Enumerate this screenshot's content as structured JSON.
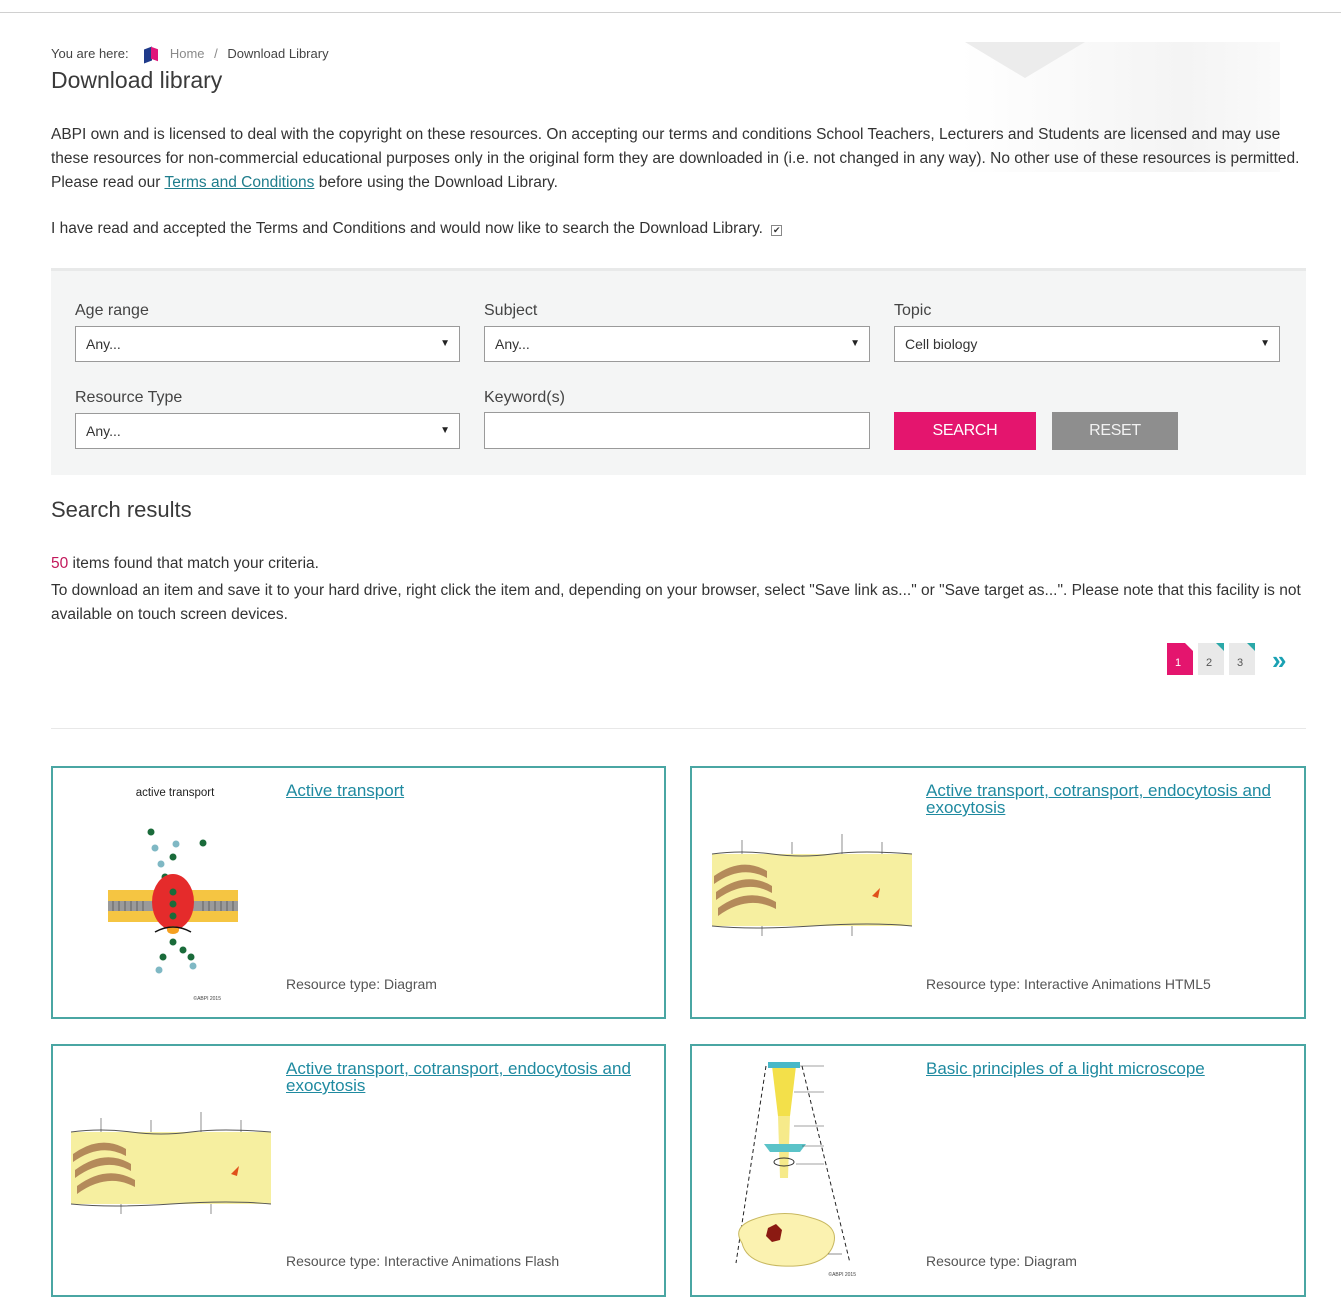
{
  "breadcrumb": {
    "prefix": "You are here:",
    "home": "Home",
    "separator": "/",
    "current": "Download Library"
  },
  "page_title": "Download library",
  "intro": {
    "text_before": "ABPI own and is licensed to deal with the copyright on these resources. On accepting our terms and conditions School Teachers, Lecturers and Students are licensed and may use these resources for non-commercial educational purposes only in the original form they are downloaded in (i.e. not changed in any way). No other use of these resources is permitted. Please read our ",
    "link": "Terms and Conditions",
    "text_after": " before using the Download Library."
  },
  "accept_text": "I have read and accepted the Terms and Conditions and would now like to search the Download Library.",
  "accept_checked": true,
  "filters": {
    "age_range": {
      "label": "Age range",
      "value": "Any..."
    },
    "subject": {
      "label": "Subject",
      "value": "Any..."
    },
    "topic": {
      "label": "Topic",
      "value": "Cell biology"
    },
    "resource_type": {
      "label": "Resource Type",
      "value": "Any..."
    },
    "keywords": {
      "label": "Keyword(s)",
      "value": ""
    },
    "search_label": "SEARCH",
    "reset_label": "RESET"
  },
  "results": {
    "title": "Search results",
    "count": "50",
    "count_suffix": " items found that match your criteria.",
    "instructions": "To download an item and save it to your hard drive, right click the item and, depending on your browser, select \"Save link as...\" or \"Save target as...\". Please note that this facility is not available on touch screen devices."
  },
  "pagination": {
    "pages": [
      "1",
      "2",
      "3"
    ],
    "current": "1",
    "next": "»"
  },
  "cards": [
    {
      "title": "Active transport",
      "type": "Resource type: Diagram",
      "thumb_caption": "active transport",
      "thumb_credit": "©ABPI 2015"
    },
    {
      "title": "Active transport, cotransport, endocytosis and exocytosis",
      "type": "Resource type: Interactive Animations HTML5"
    },
    {
      "title": "Active transport, cotransport, endocytosis and exocytosis",
      "type": "Resource type: Interactive Animations Flash"
    },
    {
      "title": "Basic principles of a light microscope",
      "type": "Resource type: Diagram",
      "thumb_credit": "©ABPI 2015"
    }
  ],
  "colors": {
    "accent_pink": "#e4156e",
    "teal_border": "#4aa6a3",
    "link_teal": "#1f8aa0",
    "reset_grey": "#8e8e8e"
  }
}
